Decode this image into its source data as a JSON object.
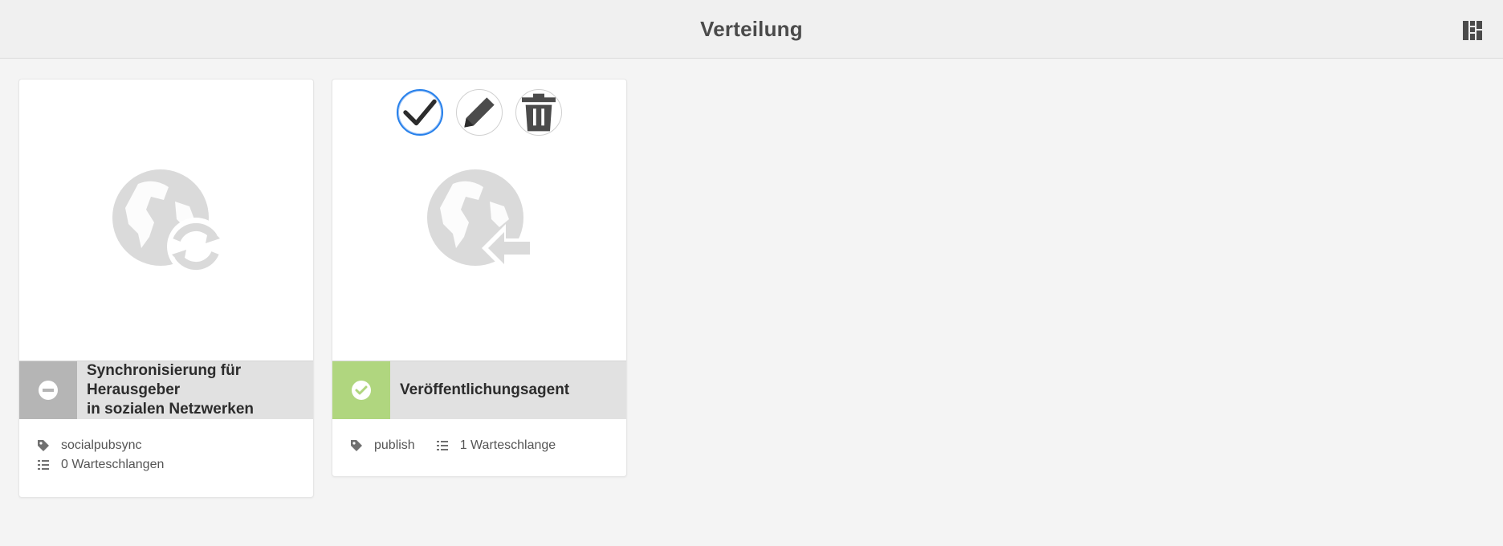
{
  "header": {
    "title": "Verteilung",
    "view_toggle_icon": "grid-view-icon"
  },
  "agents": [
    {
      "title_line1": "Synchronisierung für Herausgeber",
      "title_line2": "in sozialen Netzwerken",
      "status": "disabled",
      "status_icon": "minus-circle-icon",
      "thumbnail_icon": "globe-sync-icon",
      "tag": "socialpubsync",
      "queues": "0 Warteschlangen"
    },
    {
      "title": "Veröffentlichungsagent",
      "status": "enabled",
      "status_icon": "checkmark-circle-icon",
      "thumbnail_icon": "globe-publish-icon",
      "tag": "publish",
      "queues": "1 Warteschlange",
      "quick_actions": [
        "select",
        "edit",
        "delete"
      ]
    }
  ],
  "colors": {
    "enabled": "#b0d67f",
    "disabled": "#b5b5b5",
    "selection": "#2680eb"
  }
}
